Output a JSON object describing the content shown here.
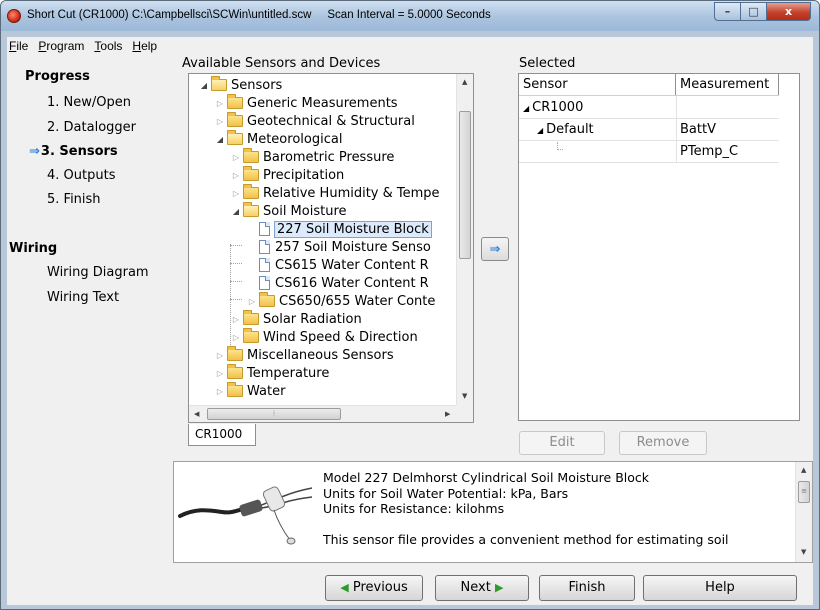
{
  "window": {
    "title": "Short Cut (CR1000) C:\\Campbellsci\\SCWin\\untitled.scw",
    "scan_interval": "Scan Interval = 5.0000 Seconds",
    "controls": {
      "minimize": "–",
      "maximize": "□",
      "close": "x"
    }
  },
  "menu": [
    "File",
    "Program",
    "Tools",
    "Help"
  ],
  "progress": {
    "title": "Progress",
    "steps": [
      "1. New/Open",
      "2. Datalogger",
      "3. Sensors",
      "4. Outputs",
      "5. Finish"
    ],
    "current_step": "3. Sensors"
  },
  "wiring": {
    "title": "Wiring",
    "links": [
      "Wiring Diagram",
      "Wiring Text"
    ]
  },
  "available": {
    "label": "Available Sensors and Devices",
    "tree": [
      {
        "label": "Sensors",
        "type": "folder",
        "level": 0,
        "expanded": true
      },
      {
        "label": "Generic Measurements",
        "type": "folder",
        "level": 1,
        "expanded": false
      },
      {
        "label": "Geotechnical & Structural",
        "type": "folder",
        "level": 1,
        "expanded": false
      },
      {
        "label": "Meteorological",
        "type": "folder",
        "level": 1,
        "expanded": true
      },
      {
        "label": "Barometric Pressure",
        "type": "folder",
        "level": 2,
        "expanded": false
      },
      {
        "label": "Precipitation",
        "type": "folder",
        "level": 2,
        "expanded": false
      },
      {
        "label": "Relative Humidity & Tempe",
        "type": "folder",
        "level": 2,
        "expanded": false
      },
      {
        "label": "Soil Moisture",
        "type": "folder",
        "level": 2,
        "expanded": true
      },
      {
        "label": "227 Soil Moisture Block",
        "type": "file",
        "level": 3,
        "selected": true
      },
      {
        "label": "257 Soil Moisture Senso",
        "type": "file",
        "level": 3
      },
      {
        "label": "CS615 Water Content R",
        "type": "file",
        "level": 3
      },
      {
        "label": "CS616 Water Content R",
        "type": "file",
        "level": 3
      },
      {
        "label": "CS650/655 Water Conte",
        "type": "folder",
        "level": 3,
        "expanded": false
      },
      {
        "label": "Solar Radiation",
        "type": "folder",
        "level": 2,
        "expanded": false
      },
      {
        "label": "Wind Speed & Direction",
        "type": "folder",
        "level": 2,
        "expanded": false
      },
      {
        "label": "Miscellaneous Sensors",
        "type": "folder",
        "level": 1,
        "expanded": false
      },
      {
        "label": "Temperature",
        "type": "folder",
        "level": 1,
        "expanded": false
      },
      {
        "label": "Water",
        "type": "folder",
        "level": 1,
        "expanded": false
      }
    ],
    "tab": "CR1000"
  },
  "add_button": "⇒",
  "selected": {
    "label": "Selected",
    "columns": [
      "Sensor",
      "Measurement"
    ],
    "rows": [
      {
        "sensor": "CR1000",
        "measurement": ""
      },
      {
        "sensor": "Default",
        "measurement": "BattV"
      },
      {
        "sensor": "",
        "measurement": "PTemp_C"
      }
    ],
    "edit_label": "Edit",
    "remove_label": "Remove"
  },
  "info": {
    "lines": [
      "Model 227 Delmhorst Cylindrical Soil Moisture Block",
      "Units for Soil Water Potential: kPa, Bars",
      "Units for Resistance: kilohms",
      "",
      "This sensor file provides a convenient method for estimating soil"
    ]
  },
  "buttons": {
    "previous": "Previous",
    "next": "Next",
    "finish": "Finish",
    "help": "Help"
  },
  "colors": {
    "accent": "#2d7ed4",
    "nav_green": "#2e9a2b",
    "close_red": "#c2422b"
  }
}
